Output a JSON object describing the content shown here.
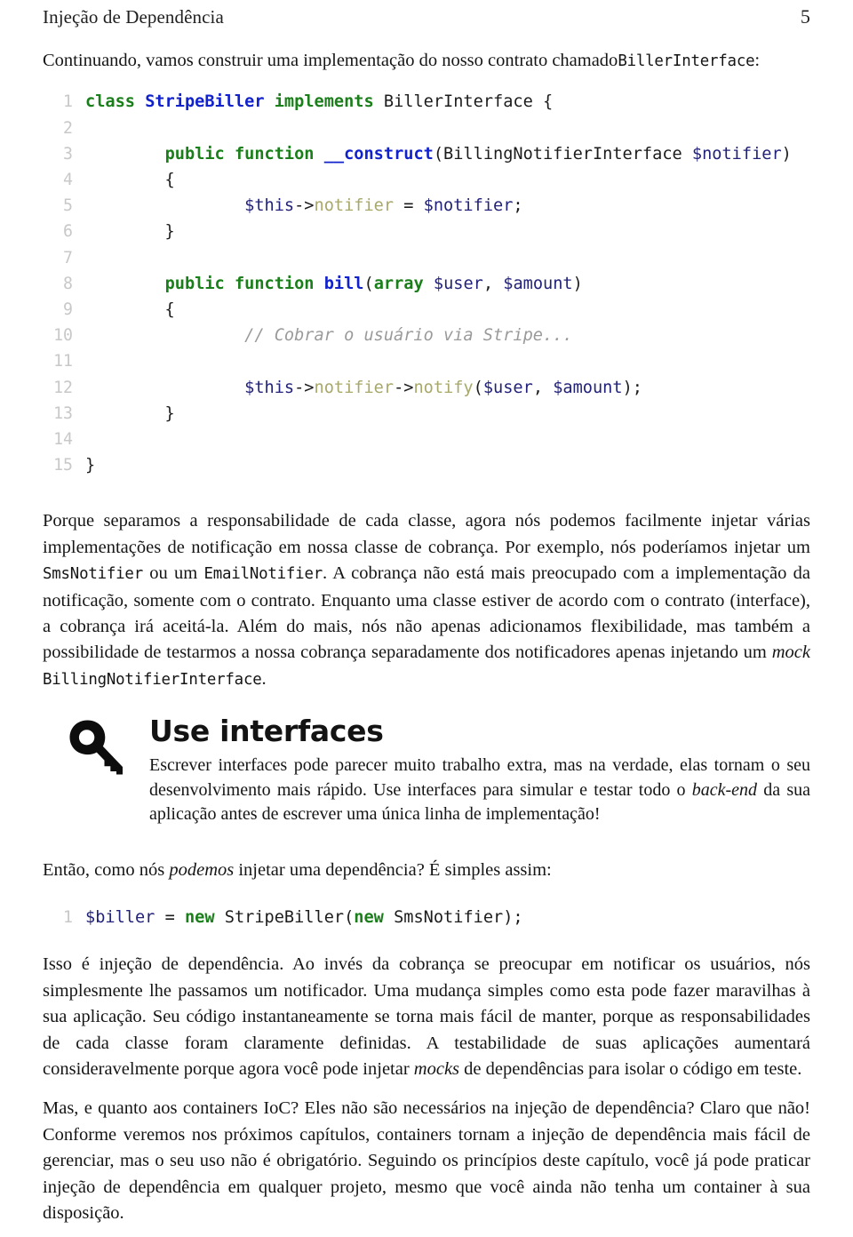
{
  "header": {
    "chapter_title": "Injeção de Dependência",
    "page_number": "5"
  },
  "intro": {
    "text_before": "Continuando, vamos construir uma implementação do nosso contrato chamado",
    "code_term": "BillerInterface",
    "text_after": ":"
  },
  "listing_one": {
    "lines": [
      {
        "n": "1",
        "tokens": [
          {
            "t": "class",
            "c": "k"
          },
          {
            "t": " ",
            "c": "pl"
          },
          {
            "t": "StripeBiller",
            "c": "cls"
          },
          {
            "t": " ",
            "c": "pl"
          },
          {
            "t": "implements",
            "c": "k"
          },
          {
            "t": " BillerInterface {",
            "c": "pl"
          }
        ]
      },
      {
        "n": "2",
        "tokens": []
      },
      {
        "n": "3",
        "tokens": [
          {
            "t": "        ",
            "c": "pl"
          },
          {
            "t": "public",
            "c": "k"
          },
          {
            "t": " ",
            "c": "pl"
          },
          {
            "t": "function",
            "c": "k"
          },
          {
            "t": " ",
            "c": "pl"
          },
          {
            "t": "__construct",
            "c": "cls"
          },
          {
            "t": "(BillingNotifierInterface ",
            "c": "pl"
          },
          {
            "t": "$notifier",
            "c": "var"
          },
          {
            "t": ")",
            "c": "pl"
          }
        ]
      },
      {
        "n": "4",
        "tokens": [
          {
            "t": "        {",
            "c": "pl"
          }
        ]
      },
      {
        "n": "5",
        "tokens": [
          {
            "t": "                ",
            "c": "pl"
          },
          {
            "t": "$this",
            "c": "var"
          },
          {
            "t": "->",
            "c": "pl"
          },
          {
            "t": "notifier",
            "c": "prop"
          },
          {
            "t": " = ",
            "c": "pl"
          },
          {
            "t": "$notifier",
            "c": "var"
          },
          {
            "t": ";",
            "c": "pl"
          }
        ]
      },
      {
        "n": "6",
        "tokens": [
          {
            "t": "        }",
            "c": "pl"
          }
        ]
      },
      {
        "n": "7",
        "tokens": []
      },
      {
        "n": "8",
        "tokens": [
          {
            "t": "        ",
            "c": "pl"
          },
          {
            "t": "public",
            "c": "k"
          },
          {
            "t": " ",
            "c": "pl"
          },
          {
            "t": "function",
            "c": "k"
          },
          {
            "t": " ",
            "c": "pl"
          },
          {
            "t": "bill",
            "c": "fn"
          },
          {
            "t": "(",
            "c": "pl"
          },
          {
            "t": "array",
            "c": "k"
          },
          {
            "t": " ",
            "c": "pl"
          },
          {
            "t": "$user",
            "c": "var"
          },
          {
            "t": ", ",
            "c": "pl"
          },
          {
            "t": "$amount",
            "c": "var"
          },
          {
            "t": ")",
            "c": "pl"
          }
        ]
      },
      {
        "n": "9",
        "tokens": [
          {
            "t": "        {",
            "c": "pl"
          }
        ]
      },
      {
        "n": "10",
        "tokens": [
          {
            "t": "                ",
            "c": "pl"
          },
          {
            "t": "// Cobrar o usuário via Stripe...",
            "c": "cmt"
          }
        ]
      },
      {
        "n": "11",
        "tokens": []
      },
      {
        "n": "12",
        "tokens": [
          {
            "t": "                ",
            "c": "pl"
          },
          {
            "t": "$this",
            "c": "var"
          },
          {
            "t": "->",
            "c": "pl"
          },
          {
            "t": "notifier",
            "c": "prop"
          },
          {
            "t": "->",
            "c": "pl"
          },
          {
            "t": "notify",
            "c": "prop"
          },
          {
            "t": "(",
            "c": "pl"
          },
          {
            "t": "$user",
            "c": "var"
          },
          {
            "t": ", ",
            "c": "pl"
          },
          {
            "t": "$amount",
            "c": "var"
          },
          {
            "t": ");",
            "c": "pl"
          }
        ]
      },
      {
        "n": "13",
        "tokens": [
          {
            "t": "        }",
            "c": "pl"
          }
        ]
      },
      {
        "n": "14",
        "tokens": []
      },
      {
        "n": "15",
        "tokens": [
          {
            "t": "}",
            "c": "pl"
          }
        ]
      }
    ]
  },
  "paragraph_one": {
    "part1": "Porque separamos a responsabilidade de cada classe, agora nós podemos facilmente injetar várias implementações de notificação em nossa classe de cobrança. Por exemplo, nós poderíamos injetar um ",
    "code1": "SmsNotifier",
    "part2": " ou um ",
    "code2": "EmailNotifier",
    "part3": ". A cobrança não está mais preocupado com a implementação da notificação, somente com o contrato. Enquanto uma classe estiver de acordo com o contrato (interface), a cobrança irá aceitá-la. Além do mais, nós não apenas adicionamos flexibilidade, mas também a possibilidade de testarmos a nossa cobrança separadamente dos notificadores apenas injetando um ",
    "italic1": "mock",
    "part4": " ",
    "code3": "BillingNotifierInterface",
    "part5": "."
  },
  "callout": {
    "icon": "key-icon",
    "title": "Use interfaces",
    "part1": "Escrever interfaces pode parecer muito trabalho extra, mas na verdade, elas tornam o seu desenvolvimento mais rápido. Use interfaces para simular e testar todo o ",
    "italic1": "back-end",
    "part2": " da sua aplicação antes de escrever uma única linha de implementação!"
  },
  "paragraph_two": {
    "part1": "Então, como nós ",
    "italic1": "podemos",
    "part2": " injetar uma dependência? É simples assim:"
  },
  "listing_two": {
    "lines": [
      {
        "n": "1",
        "tokens": [
          {
            "t": "$biller",
            "c": "var"
          },
          {
            "t": " = ",
            "c": "pl"
          },
          {
            "t": "new",
            "c": "k"
          },
          {
            "t": " StripeBiller(",
            "c": "pl"
          },
          {
            "t": "new",
            "c": "k"
          },
          {
            "t": " SmsNotifier);",
            "c": "pl"
          }
        ]
      }
    ]
  },
  "paragraph_three": {
    "part1": "Isso é injeção de dependência. Ao invés da cobrança se preocupar em notificar os usuários, nós simplesmente lhe passamos um notificador. Uma mudança simples como esta pode fazer maravilhas à sua aplicação. Seu código instantaneamente se torna mais fácil de manter, porque as responsabilidades de cada classe foram claramente definidas. A testabilidade de suas aplicações aumentará consideravelmente porque agora você pode injetar ",
    "italic1": "mocks",
    "part2": " de dependências para isolar o código em teste."
  },
  "paragraph_four": {
    "text": "Mas, e quanto aos containers IoC? Eles não são necessários na injeção de dependência? Claro que não! Conforme veremos nos próximos capítulos, containers tornam a injeção de dependência mais fácil de gerenciar, mas o seu uso não é obrigatório. Seguindo os princípios deste capítulo, você já pode praticar injeção de dependência em qualquer projeto, mesmo que você ainda não tenha um container à sua disposição."
  },
  "colors": {
    "keyword": "#1a7f1a",
    "class_name": "#1122cc",
    "variable": "#22227a",
    "property": "#a8a86a",
    "comment": "#9a9a9a",
    "line_number": "#c8c8c8",
    "text": "#151515"
  }
}
